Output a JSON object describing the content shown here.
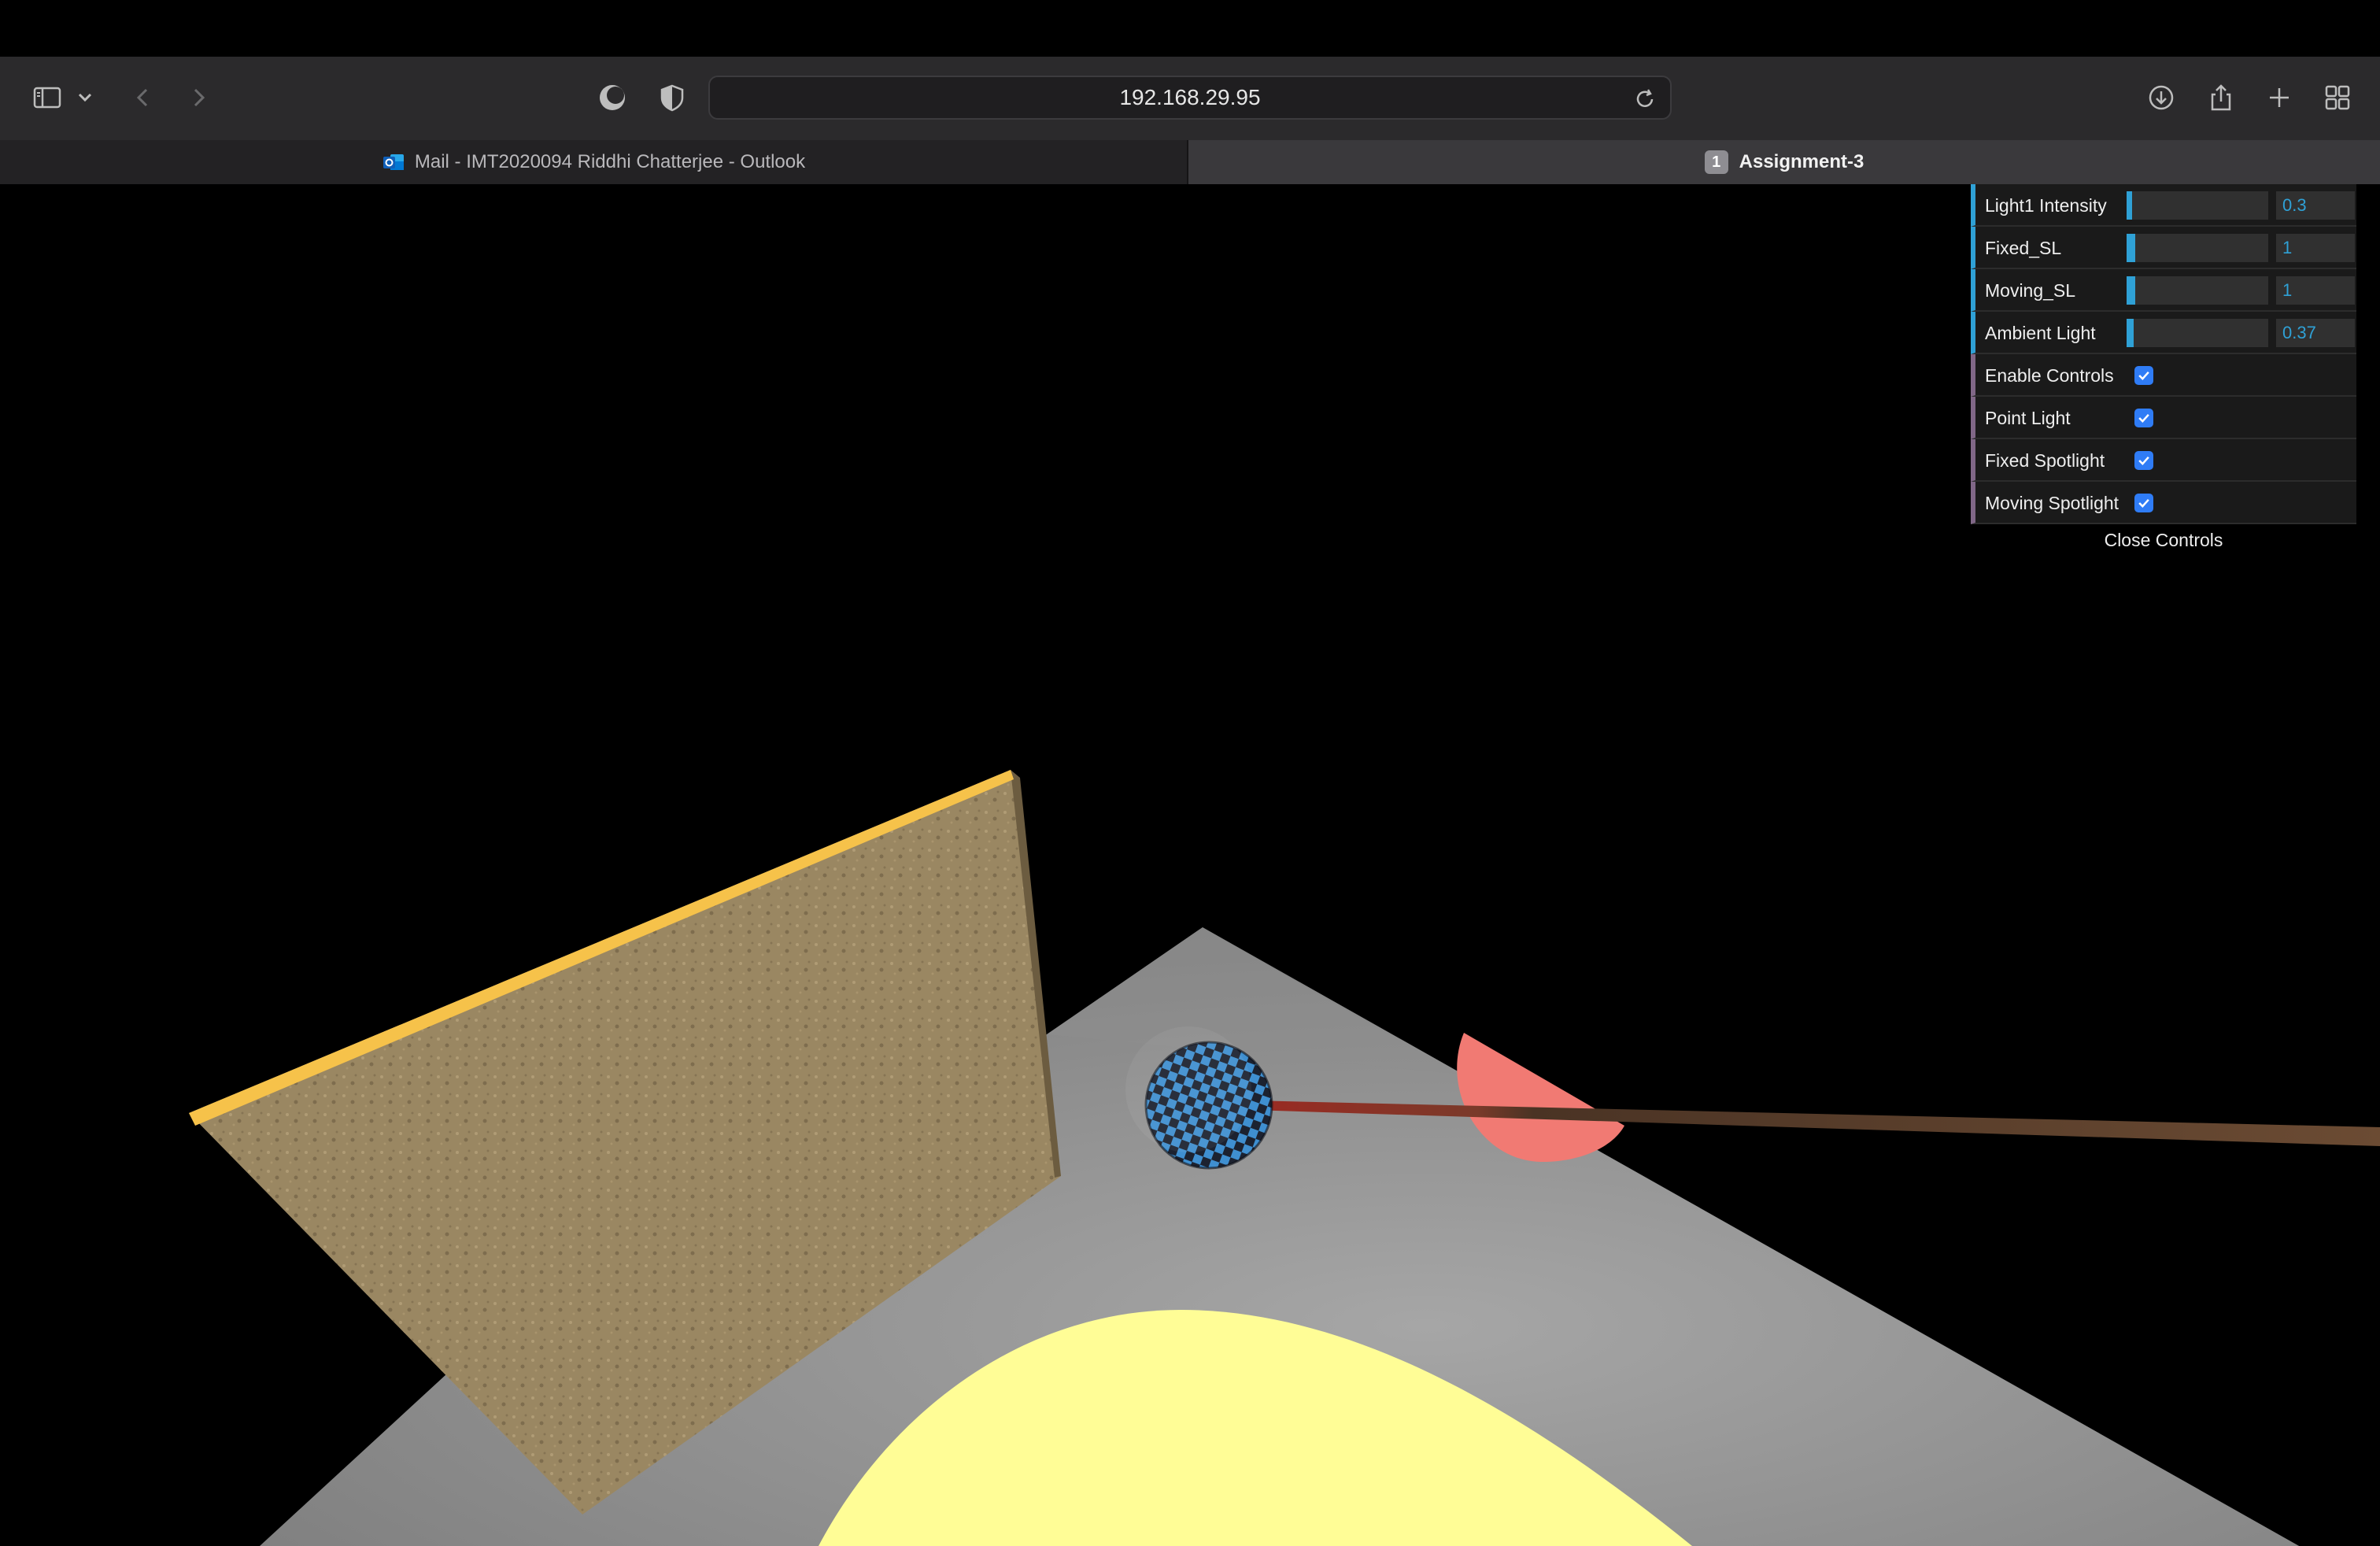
{
  "browser": {
    "url": "192.168.29.95",
    "tabs": [
      {
        "label": "Mail - IMT2020094 Riddhi Chatterjee - Outlook",
        "active": false,
        "icon": "outlook-icon"
      },
      {
        "label": "Assignment-3",
        "active": true,
        "badge": "1"
      }
    ],
    "toolbar_icons": [
      "sidebar-icon",
      "chevron-down-icon",
      "back-icon",
      "forward-icon",
      "night-mode-icon",
      "privacy-shield-icon",
      "reload-icon",
      "download-icon",
      "share-icon",
      "new-tab-icon",
      "tab-overview-icon"
    ]
  },
  "controls": {
    "numeric": [
      {
        "label": "Light1 Intensity",
        "value": "0.3",
        "fraction": 0.04
      },
      {
        "label": "Fixed_SL",
        "value": "1",
        "fraction": 0.06
      },
      {
        "label": "Moving_SL",
        "value": "1",
        "fraction": 0.06
      },
      {
        "label": "Ambient Light",
        "value": "0.37",
        "fraction": 0.05
      }
    ],
    "toggles": [
      {
        "label": "Enable Controls",
        "checked": true
      },
      {
        "label": "Point Light",
        "checked": true
      },
      {
        "label": "Fixed Spotlight",
        "checked": true
      },
      {
        "label": "Moving Spotlight",
        "checked": true
      }
    ],
    "close_label": "Close Controls"
  },
  "scene": {
    "objects": [
      "floor-plane",
      "textured-wall",
      "checkered-sphere",
      "cue-stick",
      "yellow-spotlight-patch",
      "red-spotlight-patch"
    ]
  },
  "colors": {
    "slider_accent": "#2fa1d6",
    "toggle_accent": "#806787",
    "checkbox": "#2f7cf6"
  }
}
